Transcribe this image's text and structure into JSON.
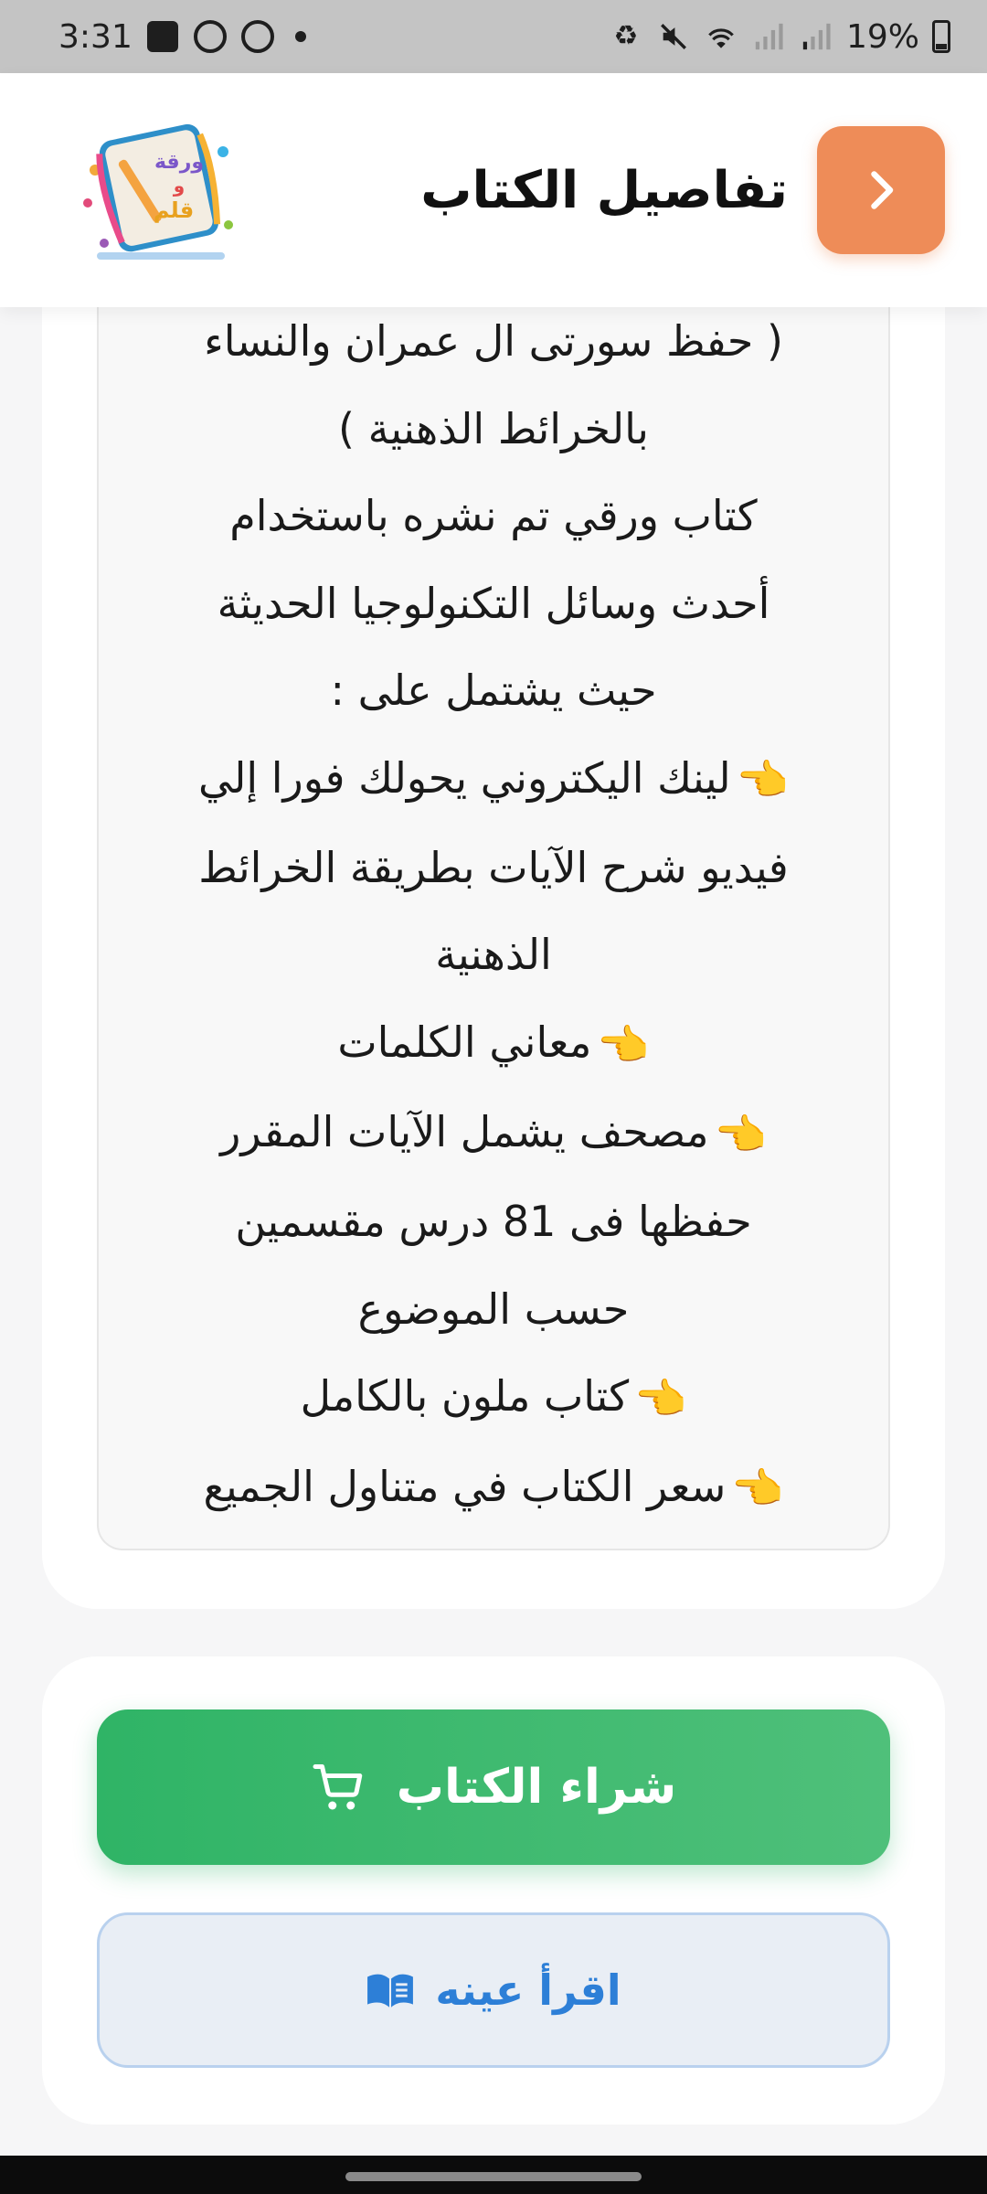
{
  "status_bar": {
    "time": "3:31",
    "battery": "19%",
    "icons": [
      "gallery-icon",
      "whatsapp-icon",
      "whatsapp-icon",
      "dot-icon",
      "recycle-icon",
      "mute-icon",
      "wifi-icon",
      "signal-icon",
      "signal-icon",
      "battery-icon"
    ]
  },
  "header": {
    "title": "تفاصيل الكتاب",
    "back_icon": "chevron-right-icon",
    "logo_text": [
      "ورقة",
      "و",
      "قلم"
    ],
    "colors": {
      "back_button": "#ee8c58"
    }
  },
  "description": {
    "lines": [
      {
        "text": "( حفظ سورتى ال عمران والنساء",
        "pointer": false
      },
      {
        "text": "بالخرائط الذهنية )",
        "pointer": false
      },
      {
        "text": "كتاب ورقي تم نشره باستخدام",
        "pointer": false
      },
      {
        "text": "أحدث وسائل التكنولوجيا الحديثة",
        "pointer": false
      },
      {
        "text": "حيث يشتمل على :",
        "pointer": false
      },
      {
        "text": "لينك اليكتروني يحولك فورا إلي",
        "pointer": true
      },
      {
        "text": "فيديو شرح الآيات بطريقة الخرائط",
        "pointer": false
      },
      {
        "text": "الذهنية",
        "pointer": false
      },
      {
        "text": "معاني الكلمات",
        "pointer": true
      },
      {
        "text": "مصحف يشمل الآيات المقرر",
        "pointer": true
      },
      {
        "text": "حفظها فى 81 درس مقسمين",
        "pointer": false
      },
      {
        "text": "حسب الموضوع",
        "pointer": false
      },
      {
        "text": "كتاب ملون بالكامل",
        "pointer": true
      },
      {
        "text": "سعر الكتاب في متناول الجميع",
        "pointer": true
      }
    ],
    "pointer_glyph": "👈"
  },
  "actions": {
    "buy_label": "شراء الكتاب",
    "buy_icon": "cart-icon",
    "sample_label": "اقرأ عينه",
    "sample_icon": "book-open-icon",
    "colors": {
      "buy": "#2fb466",
      "sample_text": "#2d7fd7",
      "sample_bg": "#e9eef5"
    }
  }
}
